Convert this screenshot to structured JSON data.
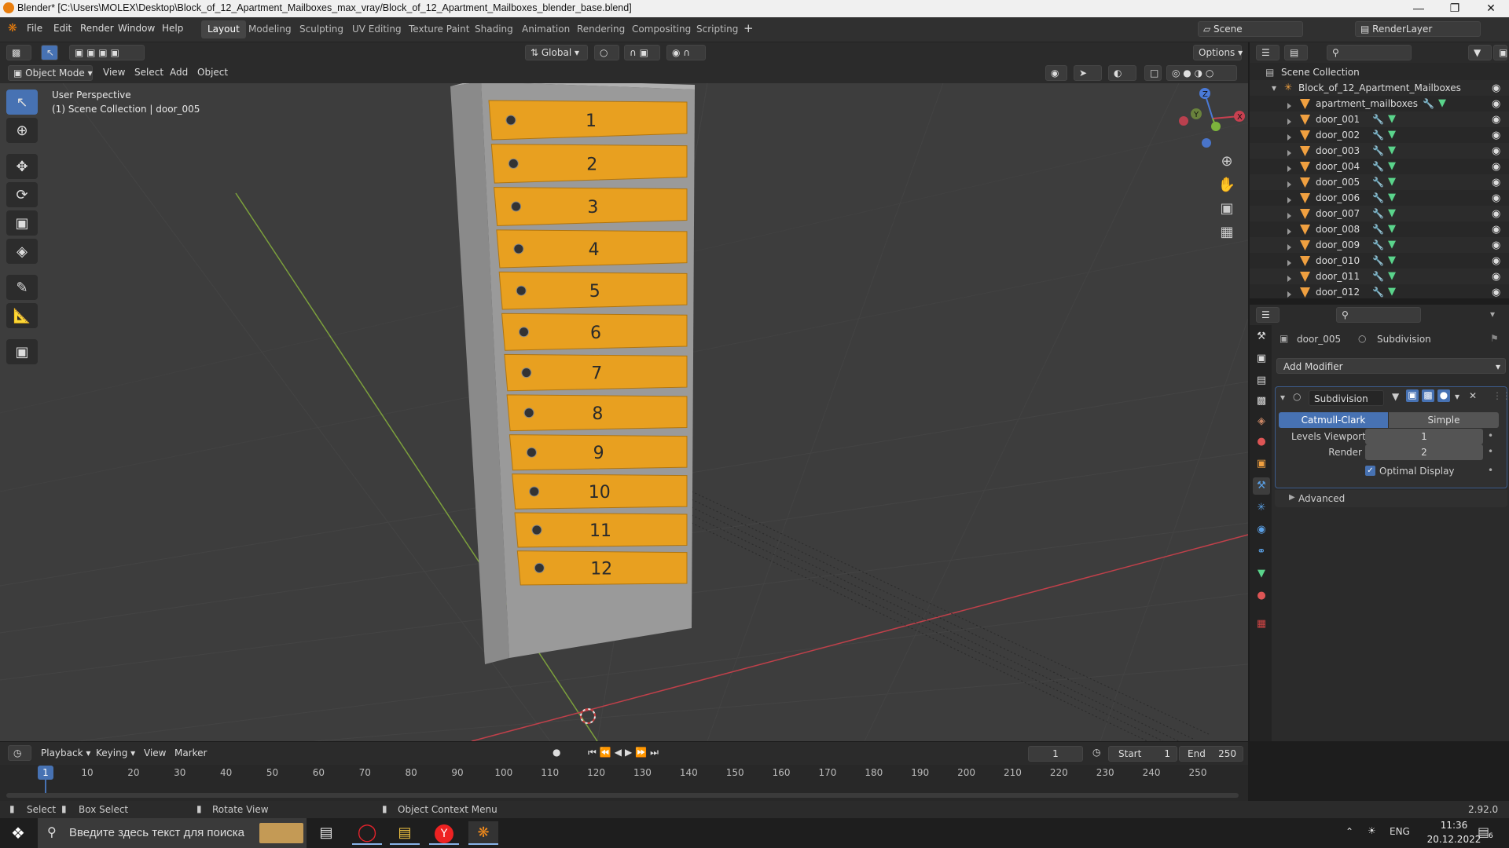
{
  "window": {
    "title": "Blender* [C:\\Users\\MOLEX\\Desktop\\Block_of_12_Apartment_Mailboxes_max_vray/Block_of_12_Apartment_Mailboxes_blender_base.blend]"
  },
  "menu": [
    "File",
    "Edit",
    "Render",
    "Window",
    "Help"
  ],
  "workspaces": [
    "Layout",
    "Modeling",
    "Sculpting",
    "UV Editing",
    "Texture Paint",
    "Shading",
    "Animation",
    "Rendering",
    "Compositing",
    "Scripting"
  ],
  "active_workspace": "Layout",
  "scene": {
    "scene_name": "Scene",
    "view_layer": "RenderLayer"
  },
  "viewport_header": {
    "transform_orientation": "Global",
    "options_label": "Options",
    "mode": "Object Mode",
    "menus": [
      "View",
      "Select",
      "Add",
      "Object"
    ]
  },
  "viewport": {
    "info_line1": "User Perspective",
    "info_line2": "(1) Scene Collection | door_005",
    "mailbox_numbers": [
      "1",
      "2",
      "3",
      "4",
      "5",
      "6",
      "7",
      "8",
      "9",
      "10",
      "11",
      "12"
    ]
  },
  "outliner": {
    "root": "Scene Collection",
    "collection": "Block_of_12_Apartment_Mailboxes",
    "objects": [
      "apartment_mailboxes",
      "door_001",
      "door_002",
      "door_003",
      "door_004",
      "door_005",
      "door_006",
      "door_007",
      "door_008",
      "door_009",
      "door_010",
      "door_011",
      "door_012"
    ],
    "active_object": "door_005"
  },
  "properties": {
    "object_name": "door_005",
    "modifier_tab": "Subdivision",
    "add_modifier_label": "Add Modifier",
    "modifier": {
      "name": "Subdivision",
      "type_options": [
        "Catmull-Clark",
        "Simple"
      ],
      "type_selected": "Catmull-Clark",
      "levels_viewport_label": "Levels Viewport",
      "levels_viewport": "1",
      "render_label": "Render",
      "render": "2",
      "optimal_display_label": "Optimal Display",
      "optimal_display": true,
      "advanced_label": "Advanced"
    }
  },
  "timeline": {
    "menus": [
      "Playback",
      "Keying",
      "View",
      "Marker"
    ],
    "current_frame": "1",
    "start_label": "Start",
    "start": "1",
    "end_label": "End",
    "end": "250",
    "ruler": [
      "1",
      "10",
      "20",
      "30",
      "40",
      "50",
      "60",
      "70",
      "80",
      "90",
      "100",
      "110",
      "120",
      "130",
      "140",
      "150",
      "160",
      "170",
      "180",
      "190",
      "200",
      "210",
      "220",
      "230",
      "240",
      "250"
    ]
  },
  "statusbar": {
    "select": "Select",
    "box_select": "Box Select",
    "rotate_view": "Rotate View",
    "context_menu": "Object Context Menu",
    "version": "2.92.0"
  },
  "taskbar": {
    "search_placeholder": "Введите здесь текст для поиска",
    "language": "ENG",
    "time": "11:36",
    "date": "20.12.2022",
    "notification_count": "6"
  },
  "colors": {
    "accent": "#4772b3",
    "mailbox_door": "#e8a020",
    "mailbox_frame": "#9a9a9a",
    "object_icon": "#f0a040",
    "mesh_icon": "#5ad48b",
    "x_axis": "#c0404a",
    "y_axis": "#7ca03c"
  }
}
